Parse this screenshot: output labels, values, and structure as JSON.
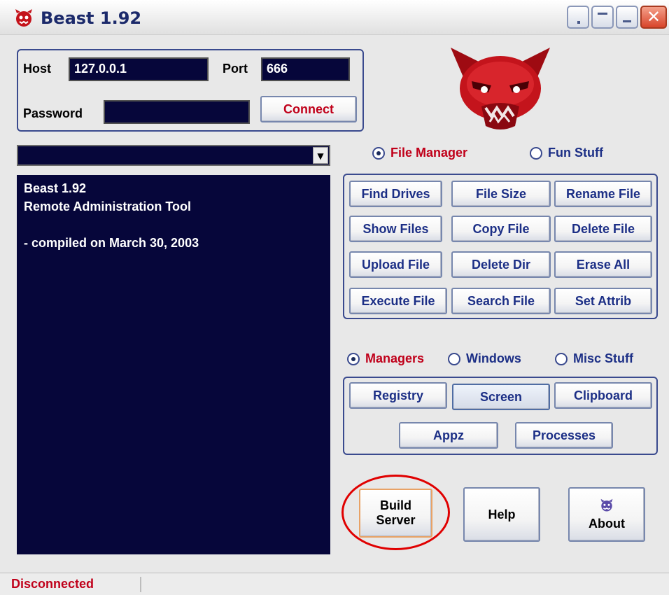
{
  "window": {
    "title": "Beast 1.92"
  },
  "connection": {
    "host_label": "Host",
    "host_value": "127.0.0.1",
    "port_label": "Port",
    "port_value": "666",
    "password_label": "Password",
    "password_value": "",
    "connect_label": "Connect"
  },
  "console": {
    "lines": [
      "Beast 1.92",
      "Remote Administration Tool",
      "",
      "- compiled on March 30, 2003"
    ]
  },
  "mode_radios": {
    "file_manager": "File Manager",
    "fun_stuff": "Fun Stuff"
  },
  "file_buttons": [
    "Find Drives",
    "File Size",
    "Rename File",
    "Show Files",
    "Copy File",
    "Delete File",
    "Upload File",
    "Delete Dir",
    "Erase All",
    "Execute File",
    "Search File",
    "Set Attrib"
  ],
  "section_radios": {
    "managers": "Managers",
    "windows": "Windows",
    "misc_stuff": "Misc Stuff"
  },
  "manager_buttons": [
    "Registry",
    "Screen",
    "Clipboard",
    "Appz",
    "Processes"
  ],
  "bottom_buttons": {
    "build_server": [
      "Build",
      "Server"
    ],
    "help": "Help",
    "about": "About"
  },
  "status": {
    "text": "Disconnected"
  },
  "colors": {
    "accent_red": "#c0001a",
    "label_blue": "#1c2f86",
    "console_bg": "#06063a"
  }
}
